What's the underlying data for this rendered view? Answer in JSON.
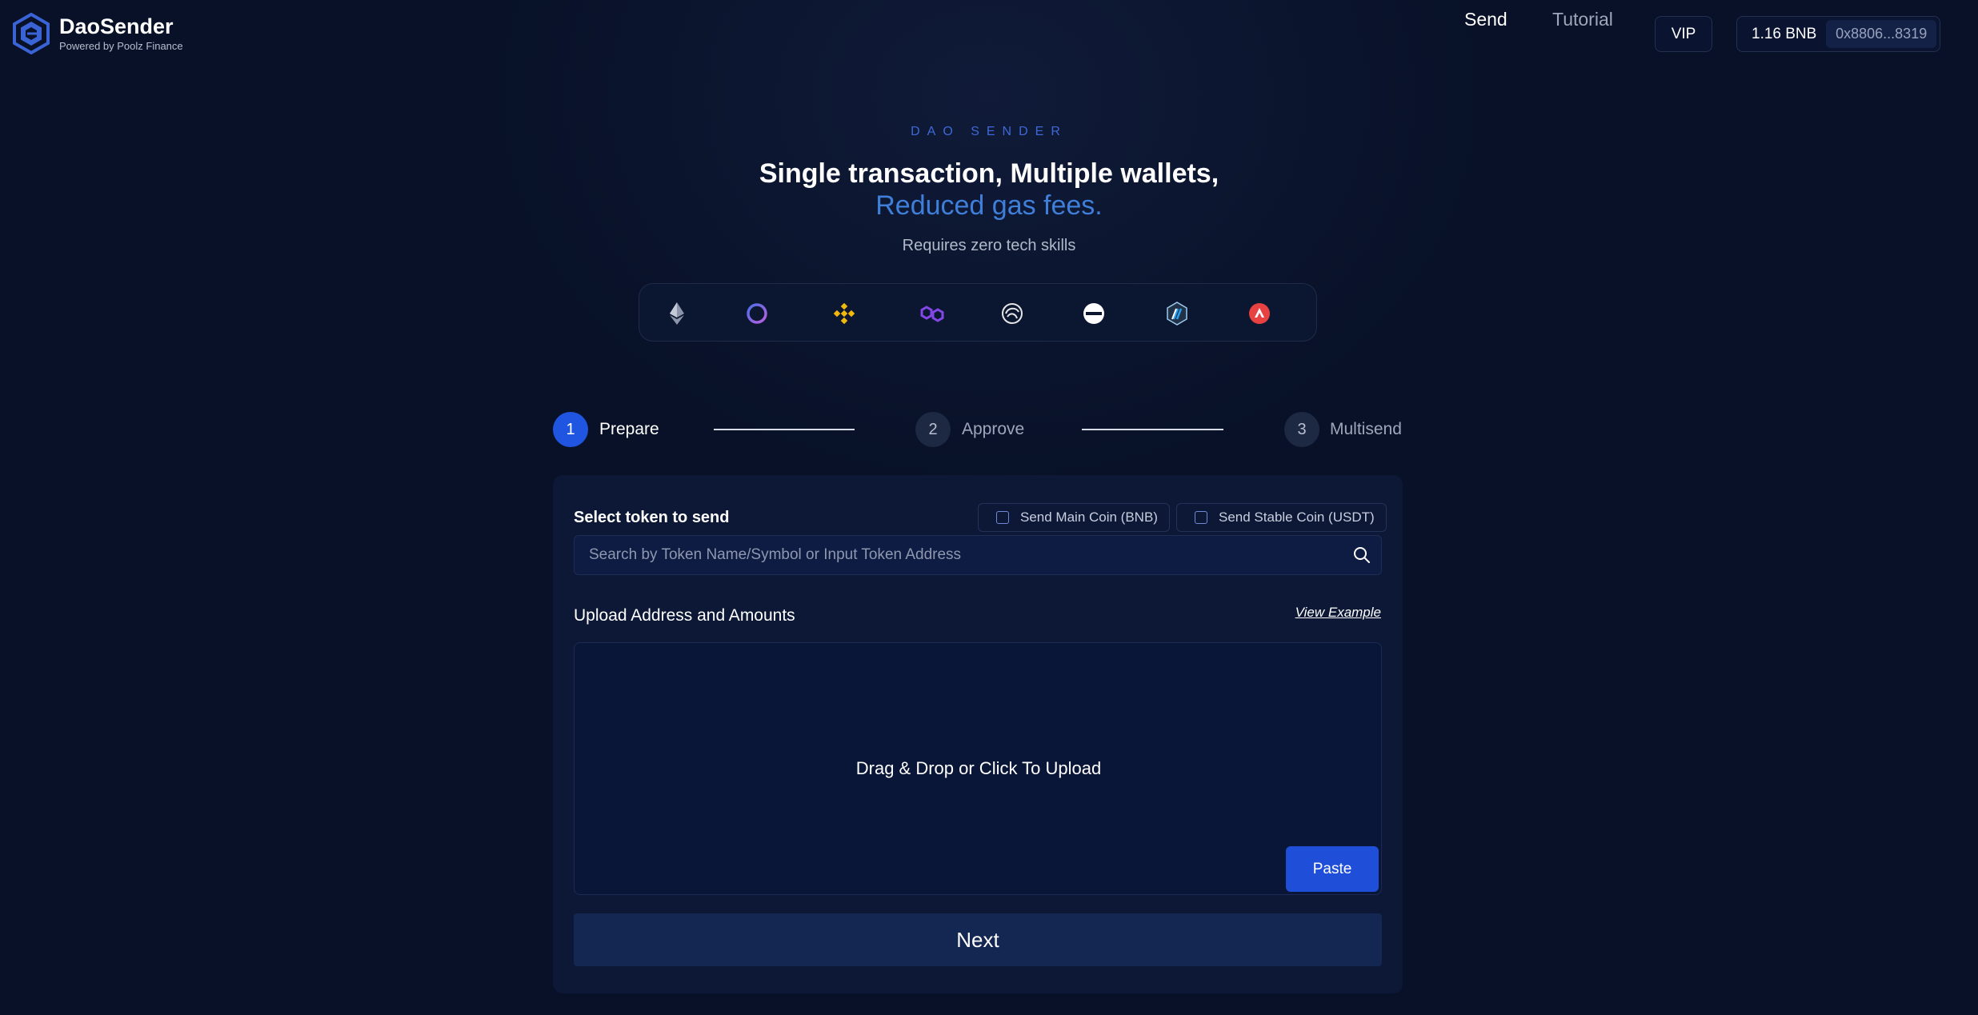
{
  "header": {
    "brand_name": "DaoSender",
    "brand_sub": "Powered by Poolz Finance",
    "nav": {
      "send": "Send",
      "tutorial": "Tutorial"
    },
    "vip_label": "VIP",
    "wallet": {
      "balance": "1.16 BNB",
      "address": "0x8806...8319"
    }
  },
  "hero": {
    "eyebrow": "DAO SENDER",
    "headline": "Single transaction, Multiple wallets,",
    "headline_accent": "Reduced gas fees.",
    "subhead": "Requires zero tech skills"
  },
  "chains": [
    {
      "icon": "ethereum-icon",
      "color": "#9aa3b5"
    },
    {
      "icon": "ring-chain-icon",
      "color": "#5d7be8"
    },
    {
      "icon": "binance-icon",
      "color": "#f0b90b"
    },
    {
      "icon": "polygon-icon",
      "color": "#8247e5"
    },
    {
      "icon": "swirl-chain-icon",
      "color": "#e6e6e6"
    },
    {
      "icon": "minus-circle-chain-icon",
      "color": "#ffffff"
    },
    {
      "icon": "arbitrum-icon",
      "color": "#28a0f0"
    },
    {
      "icon": "avalanche-icon",
      "color": "#e84142"
    }
  ],
  "stepper": {
    "steps": [
      {
        "number": "1",
        "label": "Prepare",
        "active": true
      },
      {
        "number": "2",
        "label": "Approve",
        "active": false
      },
      {
        "number": "3",
        "label": "Multisend",
        "active": false
      }
    ]
  },
  "form": {
    "select_token_label": "Select token to send",
    "main_coin_label": "Send Main Coin (BNB)",
    "stable_coin_label": "Send Stable Coin (USDT)",
    "search_placeholder": "Search by Token Name/Symbol or Input Token Address",
    "upload_title": "Upload Address and Amounts",
    "view_example": "View Example",
    "dropzone_text": "Drag & Drop or Click To Upload",
    "paste_label": "Paste",
    "next_label": "Next"
  },
  "colors": {
    "background": "#081127",
    "card": "#0c1836",
    "accent_blue": "#1f4fd8",
    "accent_text": "#3f7fd9",
    "eyebrow": "#3e68d8"
  }
}
